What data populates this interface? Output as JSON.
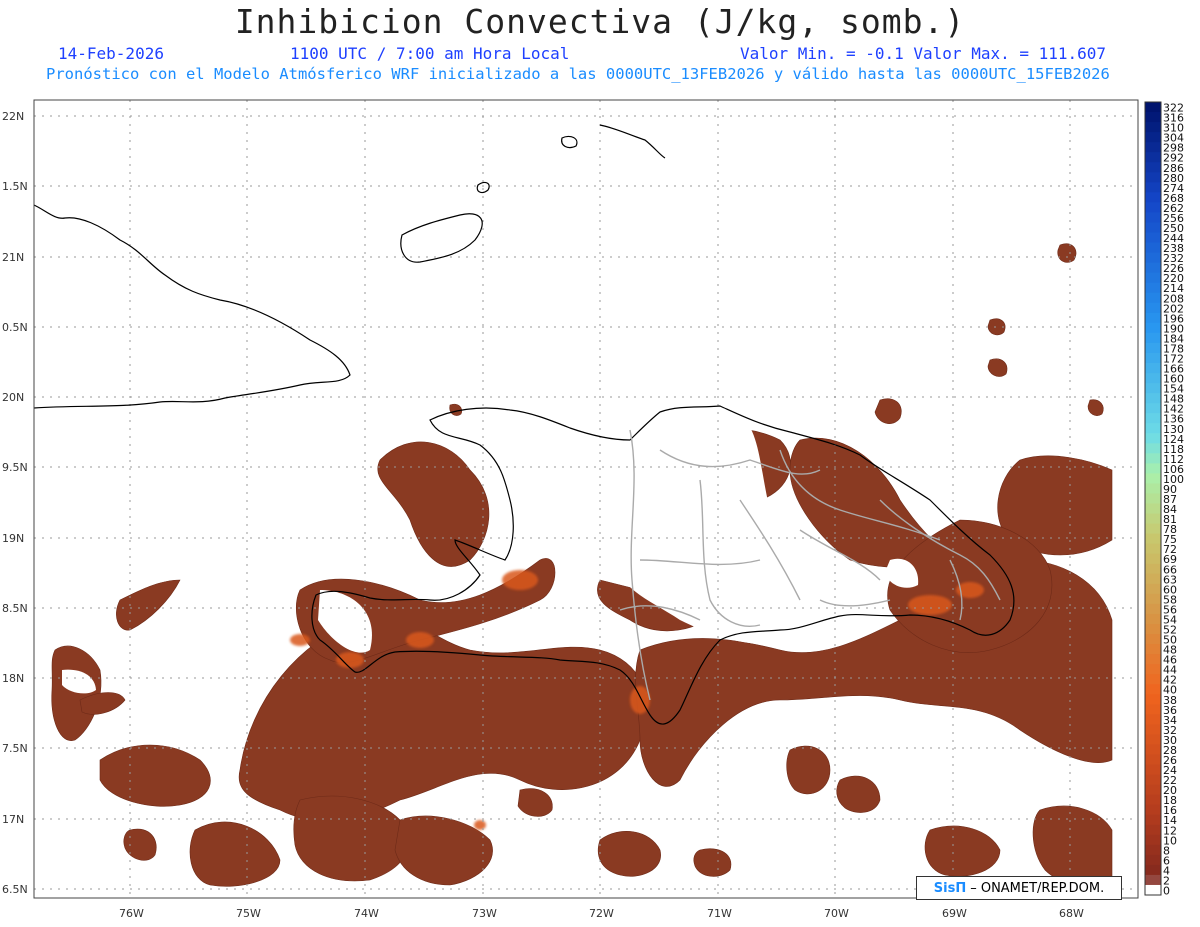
{
  "header": {
    "title": "Inhibicion Convectiva (J/kg, somb.)",
    "date": "14-Feb-2026",
    "time": "1100 UTC / 7:00 am Hora Local",
    "minmax": "Valor Min. = -0.1  Valor Max. = 111.607",
    "description": "Pronóstico con el Modelo Atmósferico WRF inicializado a las 0000UTC_13FEB2026 y válido hasta las  0000UTC_15FEB2026"
  },
  "axes": {
    "lat_labels": [
      "22N",
      "1.5N",
      "21N",
      "0.5N",
      "20N",
      "9.5N",
      "19N",
      "8.5N",
      "18N",
      "7.5N",
      "17N",
      "6.5N"
    ],
    "lon_labels": [
      "76W",
      "75W",
      "74W",
      "73W",
      "72W",
      "71W",
      "70W",
      "69W",
      "68W"
    ]
  },
  "colorbar": {
    "labels": [
      "322",
      "316",
      "310",
      "304",
      "298",
      "292",
      "286",
      "280",
      "274",
      "268",
      "262",
      "256",
      "250",
      "244",
      "238",
      "232",
      "226",
      "220",
      "214",
      "208",
      "202",
      "196",
      "190",
      "184",
      "178",
      "172",
      "166",
      "160",
      "154",
      "148",
      "142",
      "136",
      "130",
      "124",
      "118",
      "112",
      "106",
      "100",
      "90",
      "87",
      "84",
      "81",
      "78",
      "75",
      "72",
      "69",
      "66",
      "63",
      "60",
      "58",
      "56",
      "54",
      "52",
      "50",
      "48",
      "46",
      "44",
      "42",
      "40",
      "38",
      "36",
      "34",
      "32",
      "30",
      "28",
      "26",
      "24",
      "22",
      "20",
      "18",
      "16",
      "14",
      "12",
      "10",
      "8",
      "6",
      "4",
      "2",
      "0"
    ]
  },
  "credit": {
    "logo": "SisΠ",
    "text": "– ONAMET/REP.DOM."
  }
}
